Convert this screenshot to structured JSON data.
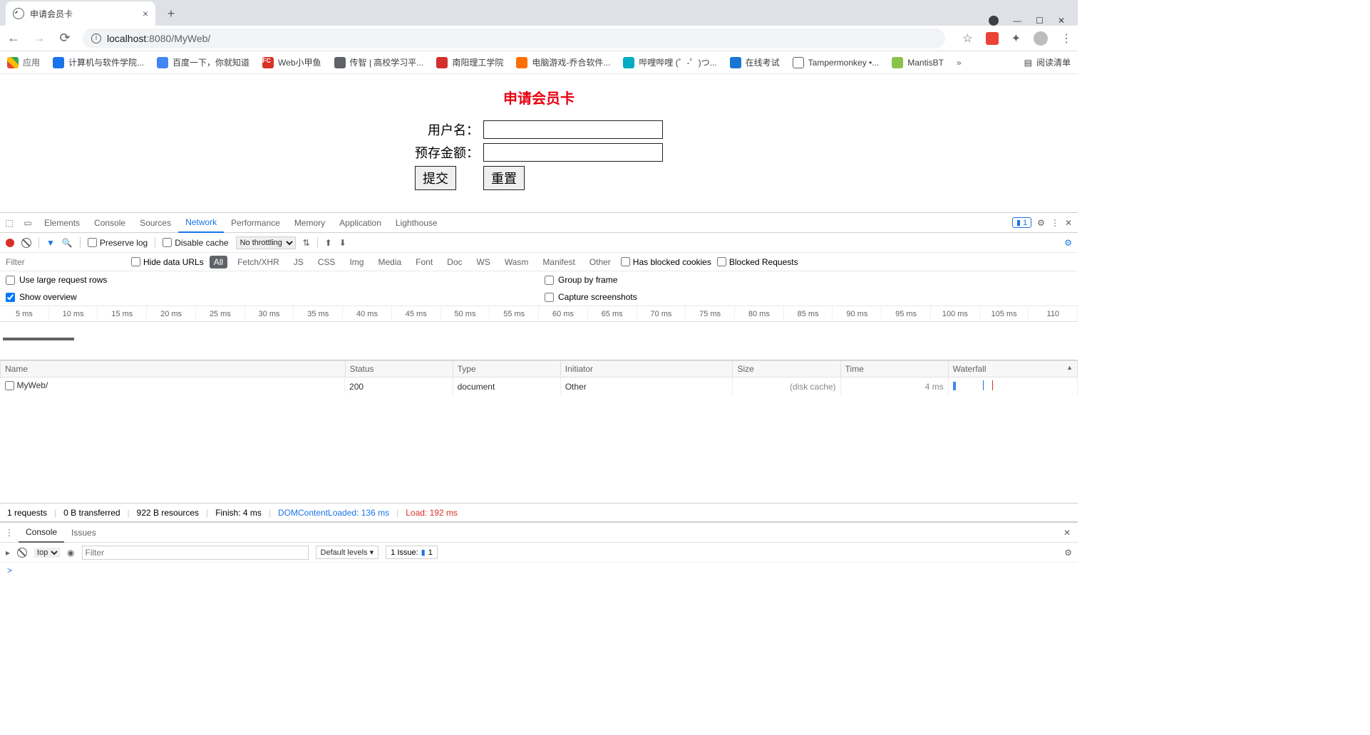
{
  "browser": {
    "tab_title": "申请会员卡",
    "url_host": "localhost",
    "url_port": ":8080",
    "url_path": "/MyWeb/",
    "apps_label": "应用",
    "reading_list": "阅读清单",
    "bookmarks": [
      {
        "label": "计算机与软件学院...",
        "icon": "blue"
      },
      {
        "label": "百度一下，你就知道",
        "icon": "paw"
      },
      {
        "label": "Web小甲鱼",
        "icon": "fc"
      },
      {
        "label": "传智 | 高校学习平...",
        "icon": "crab"
      },
      {
        "label": "南阳理工学院",
        "icon": "red"
      },
      {
        "label": "电脑游戏-乔合软件...",
        "icon": "orange"
      },
      {
        "label": "哔哩哔哩 (゜-゜)つ...",
        "icon": "tv"
      },
      {
        "label": "在线考试",
        "icon": "people"
      },
      {
        "label": "Tampermonkey •...",
        "icon": "globe"
      },
      {
        "label": "MantisBT",
        "icon": "mantis"
      }
    ]
  },
  "page": {
    "title": "申请会员卡",
    "username_label": "用户名：",
    "balance_label": "预存金额：",
    "username_value": "",
    "balance_value": "",
    "submit_label": "提交",
    "reset_label": "重置"
  },
  "devtools": {
    "tabs": [
      "Elements",
      "Console",
      "Sources",
      "Network",
      "Performance",
      "Memory",
      "Application",
      "Lighthouse"
    ],
    "active_tab": "Network",
    "issues_badge": "1",
    "toolbar": {
      "preserve_log": "Preserve log",
      "disable_cache": "Disable cache",
      "throttling": "No throttling"
    },
    "filter": {
      "placeholder": "Filter",
      "hide_data_urls": "Hide data URLs",
      "chips": [
        "All",
        "Fetch/XHR",
        "JS",
        "CSS",
        "Img",
        "Media",
        "Font",
        "Doc",
        "WS",
        "Wasm",
        "Manifest",
        "Other"
      ],
      "has_blocked_cookies": "Has blocked cookies",
      "blocked_requests": "Blocked Requests"
    },
    "options": {
      "use_large_rows": "Use large request rows",
      "group_by_frame": "Group by frame",
      "show_overview": "Show overview",
      "capture_screenshots": "Capture screenshots"
    },
    "timeline_ticks": [
      "5 ms",
      "10 ms",
      "15 ms",
      "20 ms",
      "25 ms",
      "30 ms",
      "35 ms",
      "40 ms",
      "45 ms",
      "50 ms",
      "55 ms",
      "60 ms",
      "65 ms",
      "70 ms",
      "75 ms",
      "80 ms",
      "85 ms",
      "90 ms",
      "95 ms",
      "100 ms",
      "105 ms",
      "110"
    ],
    "columns": [
      "Name",
      "Status",
      "Type",
      "Initiator",
      "Size",
      "Time",
      "Waterfall"
    ],
    "rows": [
      {
        "name": "MyWeb/",
        "status": "200",
        "type": "document",
        "initiator": "Other",
        "size": "(disk cache)",
        "time": "4 ms"
      }
    ],
    "status": {
      "requests": "1 requests",
      "transferred": "0 B transferred",
      "resources": "922 B resources",
      "finish": "Finish: 4 ms",
      "dom": "DOMContentLoaded: 136 ms",
      "load": "Load: 192 ms"
    },
    "drawer": {
      "tabs": [
        "Console",
        "Issues"
      ],
      "top_label": "top",
      "filter_placeholder": "Filter",
      "levels": "Default levels",
      "issue_label": "1 Issue:",
      "issue_count": "1",
      "prompt": ">"
    }
  }
}
